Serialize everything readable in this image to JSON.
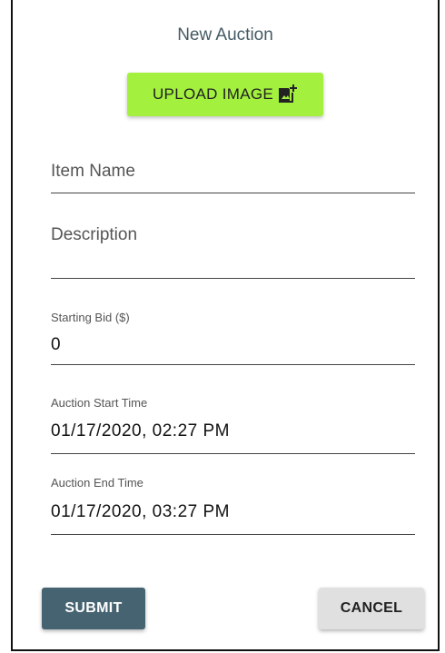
{
  "form": {
    "title": "New Auction",
    "upload_label": "UPLOAD IMAGE",
    "item_name": {
      "placeholder": "Item Name",
      "value": ""
    },
    "description": {
      "placeholder": "Description",
      "value": ""
    },
    "starting_bid": {
      "label": "Starting Bid ($)",
      "value": "0"
    },
    "start_time": {
      "label": "Auction Start Time",
      "value": "01/17/2020, 02:27 PM"
    },
    "end_time": {
      "label": "Auction End Time",
      "value": "01/17/2020, 03:27 PM"
    },
    "submit_label": "SUBMIT",
    "cancel_label": "CANCEL"
  },
  "colors": {
    "upload_button": "#a3f03e",
    "submit_button": "#456371",
    "cancel_button": "#e0e0e0",
    "title_text": "#455a64"
  },
  "icons": {
    "upload": "add-photo-icon"
  }
}
